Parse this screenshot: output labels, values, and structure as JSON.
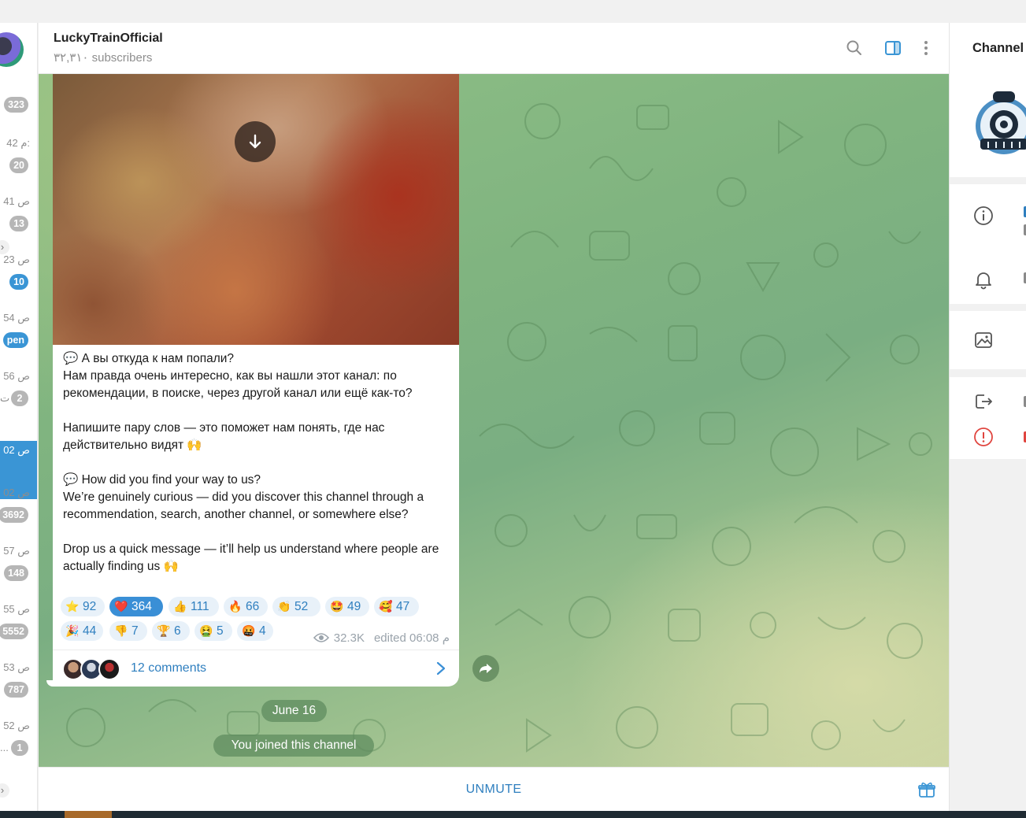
{
  "left_list": {
    "rows": [
      {
        "time": "",
        "badge": "323",
        "badge_style": "gray"
      },
      {
        "time": "م 42:",
        "badge": "20",
        "badge_style": "gray"
      },
      {
        "time": "ص 41",
        "badge": "13",
        "badge_style": "gray"
      },
      {
        "time": "ص 23",
        "badge": "10",
        "badge_style": "blue"
      },
      {
        "time": "ص 54",
        "badge": "pen",
        "badge_style": "blue"
      },
      {
        "time": "ص 56",
        "badge": "2",
        "badge_style": "gray",
        "extra": "ت"
      },
      {
        "time": "ص 02",
        "badge": "",
        "badge_style": "active"
      },
      {
        "time": "ص 02",
        "badge": "3692",
        "badge_style": "gray"
      },
      {
        "time": "ص 57",
        "badge": "148",
        "badge_style": "gray"
      },
      {
        "time": "ص 55",
        "badge": "5552",
        "badge_style": "gray"
      },
      {
        "time": "ص 53",
        "badge": "787",
        "badge_style": "gray"
      },
      {
        "time": "ص 52",
        "badge": "1",
        "badge_style": "gray",
        "extra": "..."
      }
    ]
  },
  "header": {
    "title": "LuckyTrainOfficial",
    "subtitle": "٣٢,٣١٠ subscribers",
    "icons": [
      "search-icon",
      "sidebar-toggle-icon",
      "more-vertical-icon"
    ]
  },
  "message": {
    "text": "💬 А вы откуда к нам попали?\nНам правда очень интересно, как вы нашли этот канал: по рекомендации, в поиске, через другой канал или ещё как-то?\n\nНапишите пару слов — это поможет нам понять, где нас действительно видят 🙌\n\n💬 How did you find your way to us?\nWe’re genuinely curious — did you discover this channel through a recommendation, search, another channel, or somewhere else?\n\nDrop us a quick message — it’ll help us understand where people are actually finding us 🙌",
    "reactions": [
      {
        "emoji": "⭐",
        "count": "92",
        "selected": false
      },
      {
        "emoji": "❤️",
        "count": "364",
        "selected": true
      },
      {
        "emoji": "👍",
        "count": "111",
        "selected": false
      },
      {
        "emoji": "🔥",
        "count": "66",
        "selected": false
      },
      {
        "emoji": "👏",
        "count": "52",
        "selected": false
      },
      {
        "emoji": "🤩",
        "count": "49",
        "selected": false
      },
      {
        "emoji": "🥰",
        "count": "47",
        "selected": false
      },
      {
        "emoji": "🎉",
        "count": "44",
        "selected": false
      },
      {
        "emoji": "👎",
        "count": "7",
        "selected": false
      },
      {
        "emoji": "🏆",
        "count": "6",
        "selected": false
      },
      {
        "emoji": "🤮",
        "count": "5",
        "selected": false
      },
      {
        "emoji": "🤬",
        "count": "4",
        "selected": false
      }
    ],
    "views": "32.3K",
    "edited": "edited 06:08 م",
    "comments_label": "12 comments"
  },
  "service": {
    "date": "June 16",
    "joined": "You joined this channel"
  },
  "bottom": {
    "unmute_label": "UNMUTE"
  },
  "right_panel": {
    "title": "Channel",
    "icons": [
      "info-icon",
      "bell-icon",
      "media-icon",
      "leave-icon",
      "report-icon"
    ]
  },
  "colors": {
    "accent": "#3a95d5",
    "link": "#2f7fbf",
    "chat_bg": "#80b480",
    "report_red": "#e0453f"
  }
}
